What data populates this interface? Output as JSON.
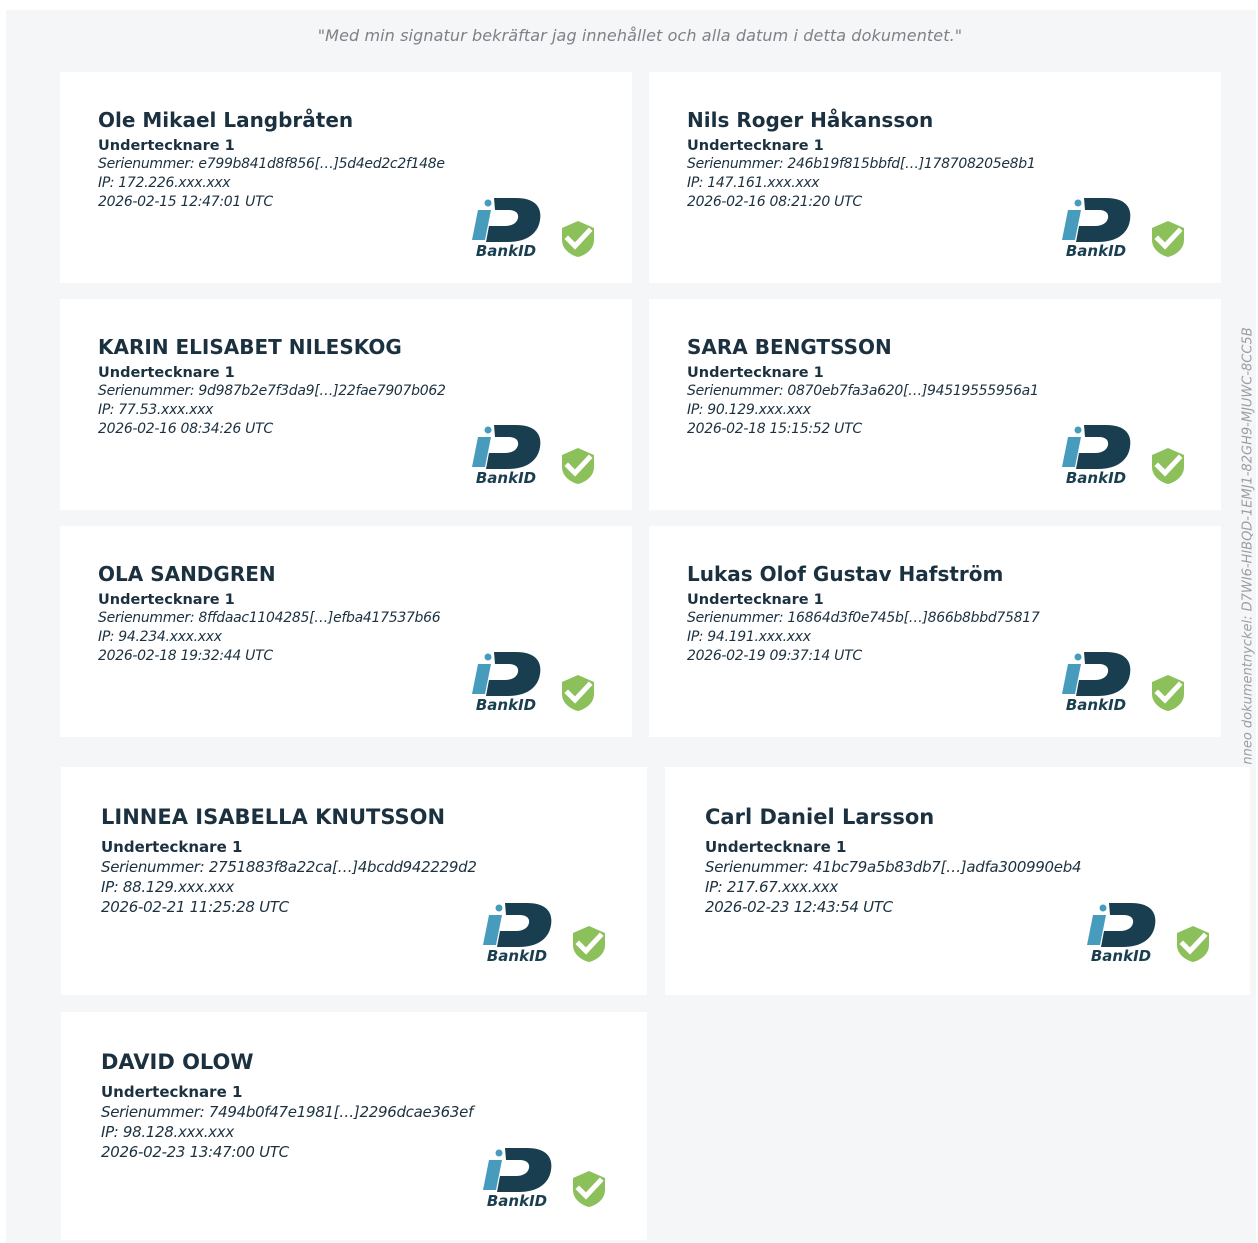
{
  "document": {
    "statement": "\"Med min signatur bekräftar jag innehållet och alla datum i detta dokumentet.\"",
    "document_key": "nneo dokumentnyckel: D7WI6-HIBQD-1EMJ1-82GH9-MJUWC-8CC5B"
  },
  "signers": [
    {
      "name": "Ole Mikael Langbråten",
      "role": "Undertecknare 1",
      "serial": "Serienummer: e799b841d8f856[…]5d4ed2c2f148e",
      "ip": "IP: 172.226.xxx.xxx",
      "timestamp": "2026-02-15 12:47:01 UTC",
      "logo_text": "BankID"
    },
    {
      "name": "Nils Roger Håkansson",
      "role": "Undertecknare 1",
      "serial": "Serienummer: 246b19f815bbfd[…]178708205e8b1",
      "ip": "IP: 147.161.xxx.xxx",
      "timestamp": "2026-02-16 08:21:20 UTC",
      "logo_text": "BankID"
    },
    {
      "name": "KARIN ELISABET NILESKOG",
      "role": "Undertecknare 1",
      "serial": "Serienummer: 9d987b2e7f3da9[…]22fae7907b062",
      "ip": "IP: 77.53.xxx.xxx",
      "timestamp": "2026-02-16 08:34:26 UTC",
      "logo_text": "BankID"
    },
    {
      "name": "SARA BENGTSSON",
      "role": "Undertecknare 1",
      "serial": "Serienummer: 0870eb7fa3a620[…]94519555956a1",
      "ip": "IP: 90.129.xxx.xxx",
      "timestamp": "2026-02-18 15:15:52 UTC",
      "logo_text": "BankID"
    },
    {
      "name": "OLA SANDGREN",
      "role": "Undertecknare 1",
      "serial": "Serienummer: 8ffdaac1104285[…]efba417537b66",
      "ip": "IP: 94.234.xxx.xxx",
      "timestamp": "2026-02-18 19:32:44 UTC",
      "logo_text": "BankID"
    },
    {
      "name": "Lukas Olof Gustav Hafström",
      "role": "Undertecknare 1",
      "serial": "Serienummer: 16864d3f0e745b[…]866b8bbd75817",
      "ip": "IP: 94.191.xxx.xxx",
      "timestamp": "2026-02-19 09:37:14 UTC",
      "logo_text": "BankID"
    },
    {
      "name": "LINNEA ISABELLA KNUTSSON",
      "role": "Undertecknare 1",
      "serial": "Serienummer: 2751883f8a22ca[…]4bcdd942229d2",
      "ip": "IP: 88.129.xxx.xxx",
      "timestamp": "2026-02-21 11:25:28 UTC",
      "logo_text": "BankID"
    },
    {
      "name": "Carl Daniel Larsson",
      "role": "Undertecknare 1",
      "serial": "Serienummer: 41bc79a5b83db7[…]adfa300990eb4",
      "ip": "IP: 217.67.xxx.xxx",
      "timestamp": "2026-02-23 12:43:54 UTC",
      "logo_text": "BankID"
    },
    {
      "name": "DAVID OLOW",
      "role": "Undertecknare 1",
      "serial": "Serienummer: 7494b0f47e1981[…]2296dcae363ef",
      "ip": "IP: 98.128.xxx.xxx",
      "timestamp": "2026-02-23 13:47:00 UTC",
      "logo_text": "BankID"
    }
  ],
  "colors": {
    "background": "#f5f6f8",
    "card": "#ffffff",
    "text_dark": "#1c3140",
    "bankid_dark": "#193e4f",
    "bankid_light": "#479cbe",
    "check_green": "#8cc05b"
  },
  "icons": [
    "bankid-logo",
    "check-shield-icon"
  ]
}
